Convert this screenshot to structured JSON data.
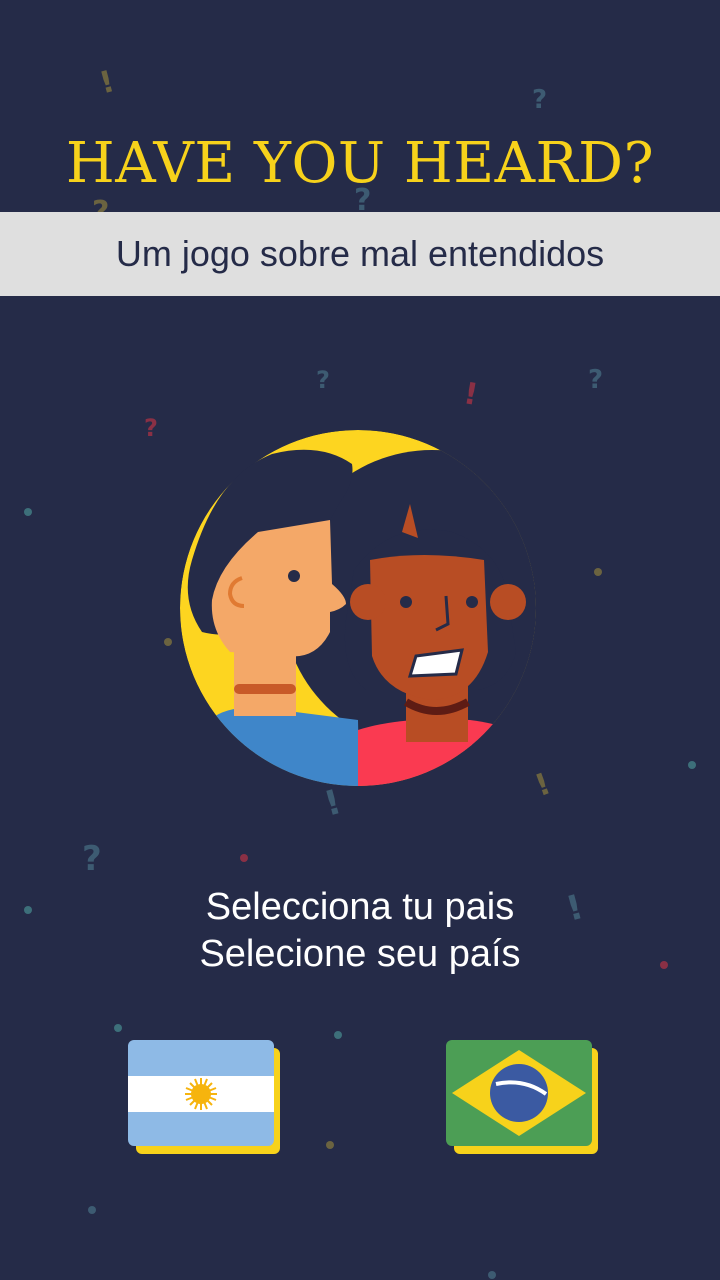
{
  "header": {
    "title": "HAVE YOU HEARD?",
    "subtitle": "Um jogo sobre mal entendidos"
  },
  "prompt": {
    "line_es": "Selecciona tu pais",
    "line_pt": "Selecione seu país"
  },
  "countries": [
    {
      "name": "argentina",
      "icon": "argentina-flag-icon"
    },
    {
      "name": "brazil",
      "icon": "brazil-flag-icon"
    }
  ],
  "colors": {
    "background": "#252b48",
    "title": "#f7d21b",
    "subtitle_bar": "#dfdfdf",
    "accent_yellow": "#f7d21b"
  }
}
